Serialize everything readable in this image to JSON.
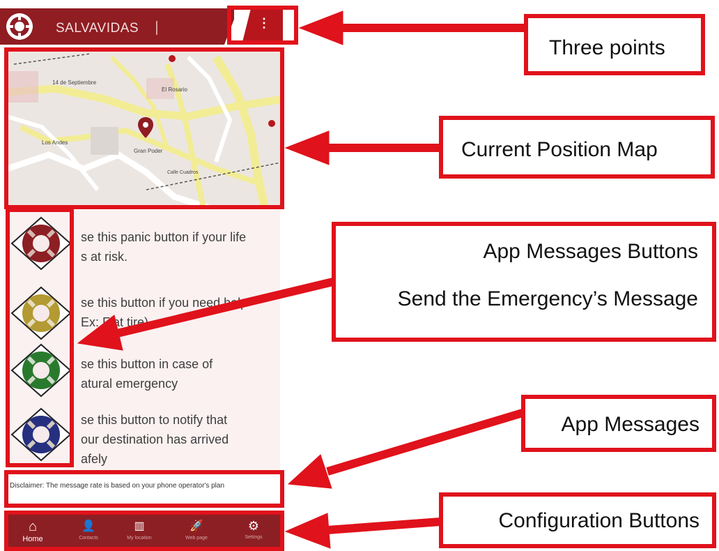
{
  "header": {
    "title": "SALVAVIDAS",
    "menu_glyph": "⋮"
  },
  "map": {
    "labels": [
      "14 de Septiembre",
      "El Rosario",
      "Los Andes",
      "Gran Poder",
      "Calle Cuadros"
    ],
    "marker_icon": "location-pin-icon"
  },
  "buttons": [
    {
      "icon": "lifebuoy-red-icon",
      "color": "#8c1f24",
      "text_lines": [
        "se this panic button if your life",
        "s at risk."
      ]
    },
    {
      "icon": "lifebuoy-yellow-icon",
      "color": "#b39a32",
      "text_lines": [
        "se this button if you need help",
        "Ex: Flat tire)"
      ]
    },
    {
      "icon": "lifebuoy-green-icon",
      "color": "#2a7a2e",
      "text_lines": [
        "se this button in case of",
        "atural emergency"
      ]
    },
    {
      "icon": "lifebuoy-blue-icon",
      "color": "#26307f",
      "text_lines": [
        "se this button to notify that",
        "our destination has arrived",
        "afely"
      ]
    }
  ],
  "disclaimer": "Disclaimer: The message rate is based on your phone operator's plan",
  "nav": [
    {
      "label": "Home",
      "icon": "home-icon",
      "glyph": "⌂"
    },
    {
      "label": "Contacts",
      "icon": "person-icon",
      "glyph": "👤"
    },
    {
      "label": "My location",
      "icon": "map-icon",
      "glyph": "▥"
    },
    {
      "label": "Web page",
      "icon": "rocket-icon",
      "glyph": "🚀"
    },
    {
      "label": "Settings",
      "icon": "gear-icon",
      "glyph": "⚙"
    }
  ],
  "annotations": {
    "three_points": "Three points",
    "map": "Current Position Map",
    "buttons_line1": "App Messages Buttons",
    "buttons_line2": "Send the Emergency’s Message",
    "messages": "App Messages",
    "config": "Configuration Buttons"
  },
  "colors": {
    "brand": "#8f1d22",
    "annotation": "#e0121b"
  }
}
